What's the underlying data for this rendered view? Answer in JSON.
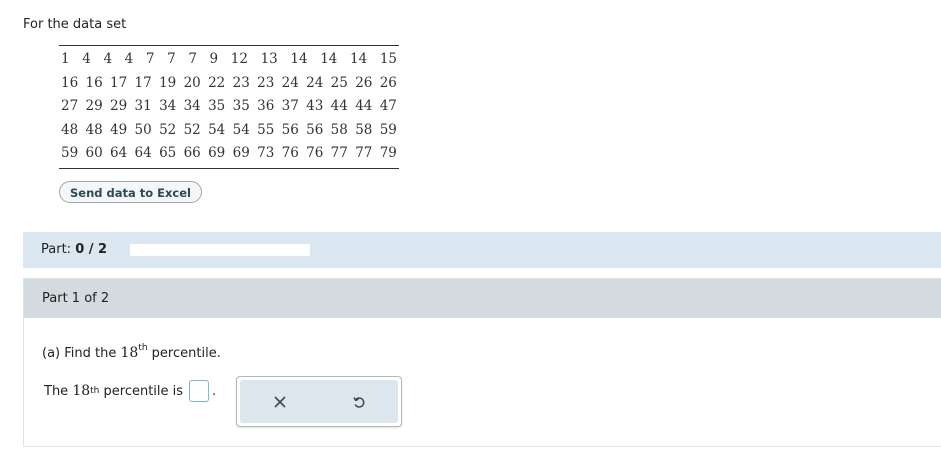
{
  "intro": "For the data set",
  "data_rows": [
    [
      "1",
      "4",
      "4",
      "4",
      "7",
      "7",
      "7",
      "9",
      "12",
      "13",
      "14",
      "14",
      "14",
      "15"
    ],
    [
      "16",
      "16",
      "17",
      "17",
      "19",
      "20",
      "22",
      "23",
      "23",
      "24",
      "24",
      "25",
      "26",
      "26"
    ],
    [
      "27",
      "29",
      "29",
      "31",
      "34",
      "34",
      "35",
      "35",
      "36",
      "37",
      "43",
      "44",
      "44",
      "47"
    ],
    [
      "48",
      "48",
      "49",
      "50",
      "52",
      "52",
      "54",
      "54",
      "55",
      "56",
      "56",
      "58",
      "58",
      "59"
    ],
    [
      "59",
      "60",
      "64",
      "64",
      "65",
      "66",
      "69",
      "69",
      "73",
      "76",
      "76",
      "77",
      "77",
      "79"
    ]
  ],
  "excel_button": "Send data to Excel",
  "progress": {
    "label_prefix": "Part: ",
    "label_value": "0 / 2",
    "fraction": 0
  },
  "part": {
    "header": "Part 1 of 2",
    "question_prefix": "(a) Find the ",
    "question_number": "18",
    "question_sup": "th",
    "question_suffix": " percentile.",
    "answer_prefix": "The ",
    "answer_number": "18",
    "answer_sup": "th",
    "answer_suffix": " percentile is",
    "answer_period": ".",
    "answer_value": ""
  },
  "tools": {
    "clear_icon": "close-icon",
    "undo_icon": "undo-icon"
  }
}
